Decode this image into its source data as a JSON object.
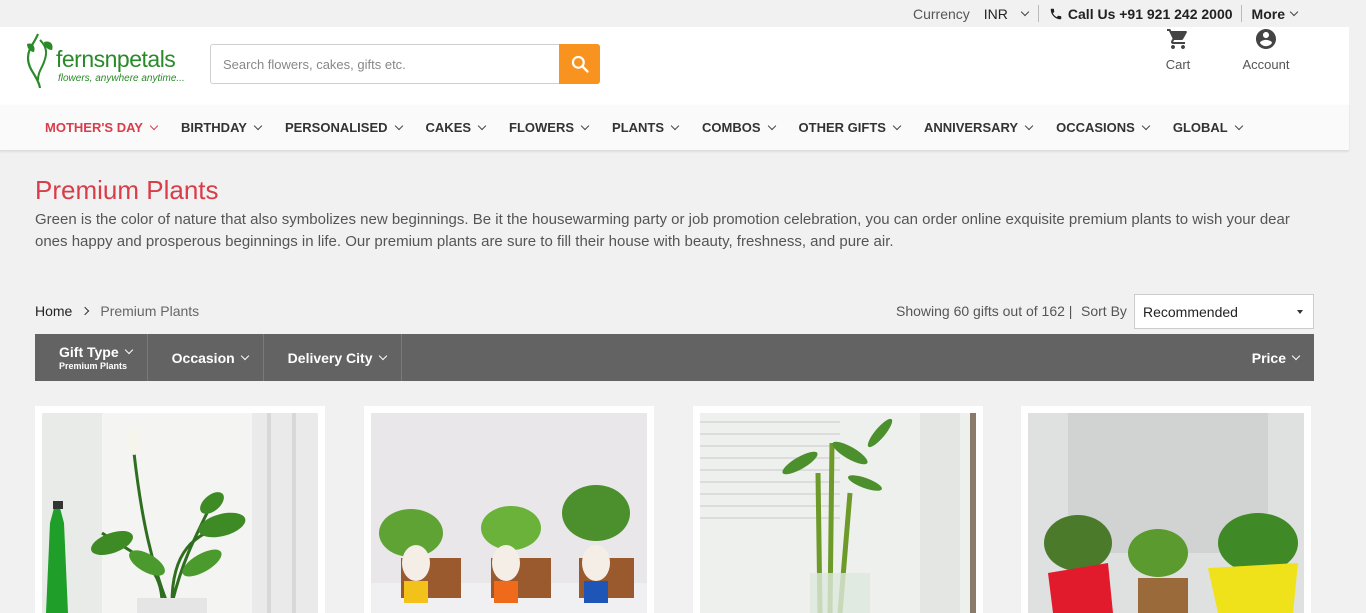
{
  "topbar": {
    "currency_label": "Currency",
    "currency_value": "INR",
    "call_label": "Call Us +91 921 242 2000",
    "more_label": "More"
  },
  "logo": {
    "name": "fernsnpetals",
    "tagline": "flowers, anywhere anytime..."
  },
  "search": {
    "placeholder": "Search flowers, cakes, gifts etc."
  },
  "header_actions": {
    "cart_label": "Cart",
    "account_label": "Account"
  },
  "nav": {
    "items": [
      {
        "label": "MOTHER'S DAY"
      },
      {
        "label": "BIRTHDAY"
      },
      {
        "label": "PERSONALISED"
      },
      {
        "label": "CAKES"
      },
      {
        "label": "FLOWERS"
      },
      {
        "label": "PLANTS"
      },
      {
        "label": "COMBOS"
      },
      {
        "label": "OTHER GIFTS"
      },
      {
        "label": "ANNIVERSARY"
      },
      {
        "label": "OCCASIONS"
      },
      {
        "label": "GLOBAL"
      }
    ]
  },
  "page": {
    "title": "Premium Plants",
    "description": "Green is the color of nature that also symbolizes new beginnings. Be it the housewarming party or job promotion celebration, you can order online exquisite premium plants to wish your dear ones happy and prosperous beginnings in life. Our premium plants are sure to fill their house with beauty, freshness, and pure air."
  },
  "breadcrumb": {
    "home": "Home",
    "current": "Premium Plants"
  },
  "results": {
    "showing": "Showing 60 gifts out of 162 |",
    "sort_label": "Sort By",
    "sort_value": "Recommended"
  },
  "filters": {
    "gift_type": "Gift Type",
    "gift_type_selected": "Premium Plants",
    "occasion": "Occasion",
    "delivery_city": "Delivery City",
    "price": "Price"
  },
  "colors": {
    "accent": "#d93d4a",
    "search_button": "#f7931e",
    "filter_bar": "#636363",
    "brand_green": "#2a8a2a"
  }
}
